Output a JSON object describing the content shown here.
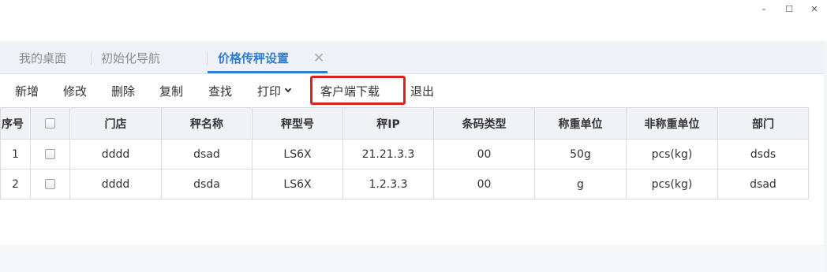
{
  "window": {
    "minimize": "–",
    "maximize": "☐",
    "close": "✕"
  },
  "tabs": [
    {
      "label": "我的桌面",
      "active": false
    },
    {
      "label": "初始化导航",
      "active": false
    },
    {
      "label": "价格传秤设置",
      "active": true,
      "closable": true,
      "close_glyph": "✕"
    }
  ],
  "toolbar": {
    "add": "新增",
    "edit": "修改",
    "delete": "删除",
    "copy": "复制",
    "find": "查找",
    "print": "打印",
    "client_download": "客户端下载",
    "exit": "退出"
  },
  "table": {
    "headers": [
      "序号",
      "",
      "门店",
      "秤名称",
      "秤型号",
      "秤IP",
      "条码类型",
      "称重单位",
      "非称重单位",
      "部门"
    ],
    "rows": [
      {
        "no": "1",
        "store": "dddd",
        "scale_name": "dsad",
        "scale_model": "LS6X",
        "scale_ip": "21.21.3.3",
        "barcode_type": "00",
        "weigh_unit": "50g",
        "non_weigh_unit": "pcs(kg)",
        "dept": "dsds"
      },
      {
        "no": "2",
        "store": "dddd",
        "scale_name": "dsda",
        "scale_model": "LS6X",
        "scale_ip": "1.2.3.3",
        "barcode_type": "00",
        "weigh_unit": "g",
        "non_weigh_unit": "pcs(kg)",
        "dept": "dsad"
      }
    ]
  },
  "colors": {
    "accent": "#2f7bd6",
    "highlight": "#e0201b"
  }
}
